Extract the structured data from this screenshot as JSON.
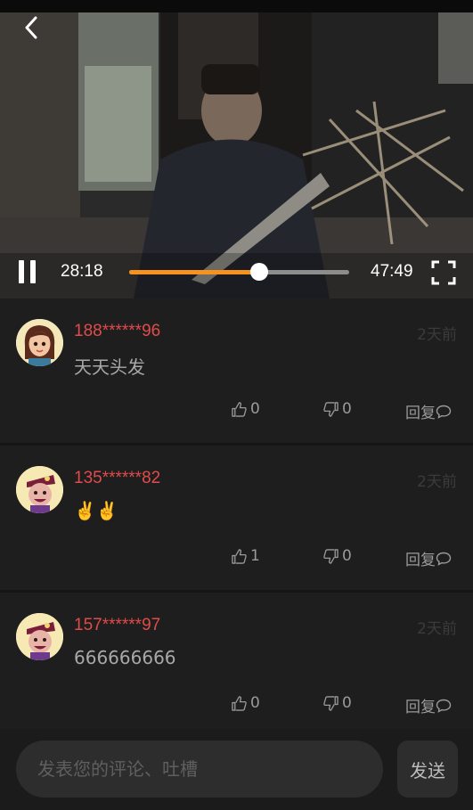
{
  "player": {
    "current_time": "28:18",
    "total_time": "47:49",
    "progress": 0.59,
    "state": "playing",
    "accent_color": "#f6921e"
  },
  "icons": {
    "back": "chevron-left-icon",
    "pause": "pause-icon",
    "fullscreen": "fullscreen-icon",
    "like": "thumbs-up-icon",
    "dislike": "thumbs-down-icon",
    "reply": "speech-bubble-icon"
  },
  "comments": [
    {
      "user": "188******96",
      "time": "2天前",
      "text": "天天头发",
      "likes": "0",
      "dislikes": "0",
      "reply_label": "回复"
    },
    {
      "user": "135******82",
      "time": "2天前",
      "text": "✌️✌️",
      "likes": "1",
      "dislikes": "0",
      "reply_label": "回复"
    },
    {
      "user": "157******97",
      "time": "2天前",
      "text": "666666666",
      "likes": "0",
      "dislikes": "0",
      "reply_label": "回复"
    }
  ],
  "composer": {
    "placeholder": "发表您的评论、吐槽",
    "value": "",
    "send_label": "发送"
  },
  "colors": {
    "username": "#e14b4b",
    "background": "#1b1b1b"
  }
}
